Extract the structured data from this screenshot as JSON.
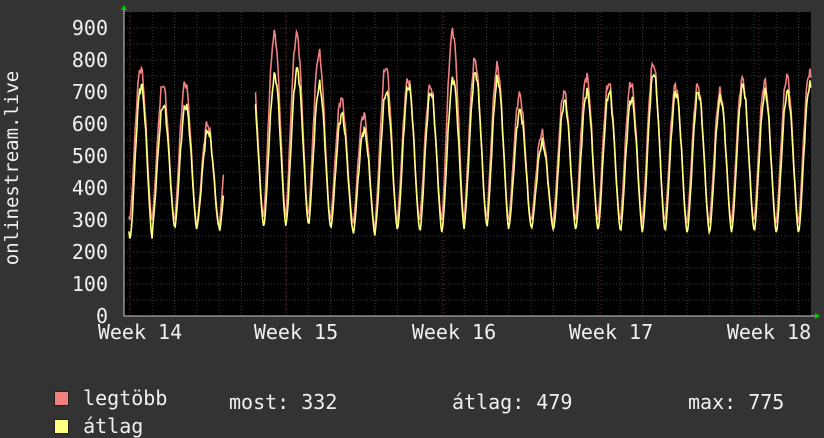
{
  "colors": {
    "background": "#333333",
    "plot_background": "#000000",
    "grid": "#3a3a3a",
    "grid_major": "#6b2a2a",
    "axis": "#00cc00",
    "max_series": "#f07f7f",
    "avg_series": "#ffff80"
  },
  "chart_data": {
    "type": "line",
    "ylabel": "onlinestream.live",
    "ylim": [
      0,
      950
    ],
    "yticks": [
      "0",
      "100",
      "200",
      "300",
      "400",
      "500",
      "600",
      "700",
      "800",
      "900"
    ],
    "xticks": [
      "Week 14",
      "Week 15",
      "Week 16",
      "Week 17",
      "Week 18"
    ],
    "grid": true,
    "daily_series": {
      "max_peaks": [
        775,
        725,
        730,
        600,
        640,
        760,
        880,
        880,
        820,
        680,
        630,
        780,
        740,
        720,
        890,
        800,
        780,
        690,
        570,
        700,
        750,
        730,
        730,
        790,
        720,
        720,
        700,
        740,
        730,
        750,
        760,
        650
      ],
      "max_troughs": [
        300,
        300,
        290,
        280,
        280,
        310,
        310,
        320,
        300,
        300,
        270,
        290,
        300,
        300,
        300,
        310,
        300,
        300,
        290,
        300,
        300,
        300,
        290,
        300,
        290,
        290,
        290,
        300,
        290,
        290,
        290,
        290
      ],
      "avg_peaks": [
        720,
        660,
        660,
        580,
        560,
        700,
        750,
        770,
        720,
        630,
        580,
        700,
        720,
        700,
        740,
        760,
        740,
        640,
        540,
        670,
        700,
        700,
        680,
        760,
        700,
        700,
        680,
        720,
        700,
        700,
        720,
        620
      ],
      "avg_troughs": [
        240,
        280,
        270,
        280,
        260,
        280,
        280,
        290,
        280,
        270,
        250,
        270,
        270,
        260,
        270,
        290,
        270,
        280,
        270,
        270,
        270,
        270,
        260,
        270,
        260,
        260,
        260,
        270,
        260,
        260,
        260,
        260
      ],
      "gaps": [
        [
          4.2,
          5.6
        ]
      ]
    }
  },
  "legend": {
    "max_label": "legtöbb",
    "avg_label": "átlag",
    "now_label": "most: 332",
    "avg_stat_label": "átlag: 479",
    "max_stat_label": "max: 775"
  }
}
